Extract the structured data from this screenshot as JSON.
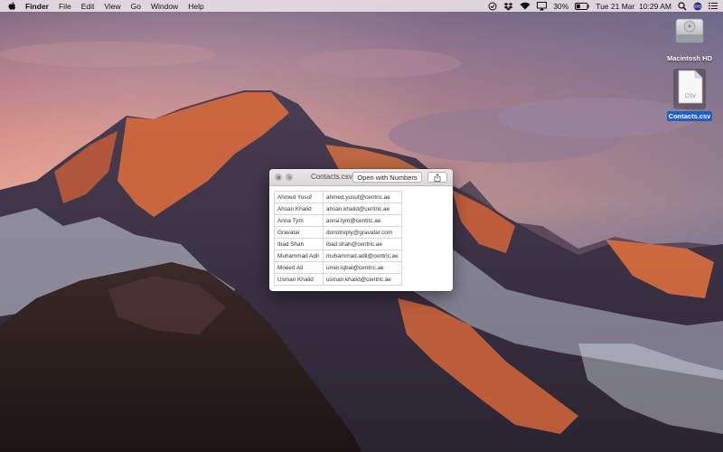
{
  "menubar": {
    "app_name": "Finder",
    "menus": [
      "File",
      "Edit",
      "View",
      "Go",
      "Window",
      "Help"
    ],
    "battery": "30%",
    "datetime": "Tue 21 Mar  10:29 AM",
    "icons": [
      "apple-icon",
      "vpn-check-icon",
      "dropbox-icon",
      "wifi-icon",
      "airplay-icon",
      "battery-icon",
      "spotlight-icon",
      "siri-icon",
      "notification-center-icon"
    ]
  },
  "desktop": {
    "items": [
      {
        "label": "Macintosh HD",
        "icon": "hard-drive-icon",
        "selected": false
      },
      {
        "label": "Contacts.csv",
        "icon": "csv-file-icon",
        "selected": true
      }
    ]
  },
  "quicklook": {
    "title": "Contacts.csv",
    "open_button": "Open with Numbers",
    "share_icon": "share-icon",
    "rows": [
      [
        "Ahmed Yusuf",
        "ahmed.yusuf@centric.ae"
      ],
      [
        "Ahsan Khalid",
        "ahsan.khalid@centric.ae"
      ],
      [
        "Anna Tym",
        "anna.tym@centric.ae"
      ],
      [
        "Gravatar",
        "donotreply@gravatar.com"
      ],
      [
        "Ibad Shah",
        "ibad.shah@centric.ae"
      ],
      [
        "Muhammad Adil",
        "muhammad.adil@centric.ae"
      ],
      [
        "Moeed Ali",
        "umer.iqbal@centric.ae"
      ],
      [
        "Usman Khalid",
        "usman.khalid@centric.ae"
      ]
    ]
  },
  "colors": {
    "selection": "#1a5fd0",
    "menubar_bg": "#ece4e8",
    "sky_top": "#8a6f86",
    "sky_glow": "#e89a86"
  }
}
